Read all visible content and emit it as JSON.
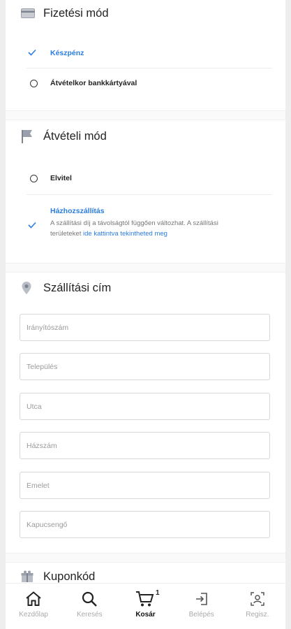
{
  "payment": {
    "title": "Fizetési mód",
    "options": [
      {
        "label": "Készpénz",
        "selected": true
      },
      {
        "label": "Átvételkor bankkártyával",
        "selected": false
      }
    ]
  },
  "pickup": {
    "title": "Átvételi mód",
    "options": [
      {
        "label": "Elvitel",
        "selected": false
      },
      {
        "label": "Házhozszállítás",
        "selected": true
      }
    ],
    "delivery_desc_1": "A szállítási díj a távolságtól függően változhat. A szállítási",
    "delivery_desc_2": "területeket",
    "delivery_link": "ide kattintva tekintheted meg"
  },
  "address": {
    "title": "Szállítási cím",
    "fields": [
      {
        "placeholder": "Irányítószám",
        "value": ""
      },
      {
        "placeholder": "Település",
        "value": ""
      },
      {
        "placeholder": "Utca",
        "value": ""
      },
      {
        "placeholder": "Házszám",
        "value": ""
      },
      {
        "placeholder": "Emelet",
        "value": ""
      },
      {
        "placeholder": "Kapucsengő",
        "value": ""
      }
    ]
  },
  "coupon": {
    "title": "Kuponkód"
  },
  "tabbar": {
    "items": [
      {
        "label": "Kezdőlap",
        "icon": "home-icon",
        "active": false
      },
      {
        "label": "Keresés",
        "icon": "search-icon",
        "active": false
      },
      {
        "label": "Kosár",
        "icon": "cart-icon",
        "active": true,
        "badge": "1"
      },
      {
        "label": "Belépés",
        "icon": "login-icon",
        "active": false
      },
      {
        "label": "Regisz.",
        "icon": "register-icon",
        "active": false
      }
    ]
  },
  "colors": {
    "accent": "#2a7de1",
    "text": "#222222",
    "muted": "#aaaaaa"
  }
}
